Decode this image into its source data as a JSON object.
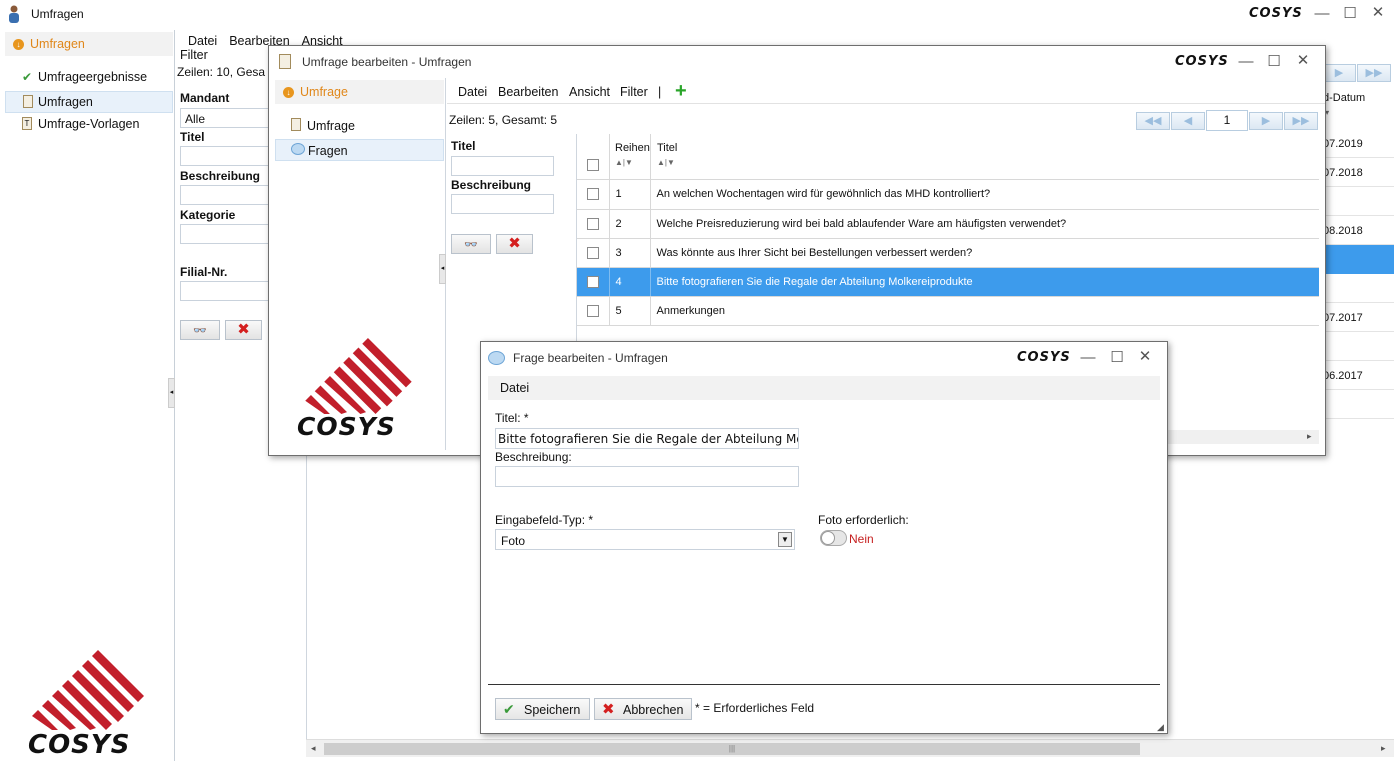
{
  "main_window": {
    "title": "Umfragen",
    "nav_header": "Umfragen",
    "nav_items": [
      {
        "label": "Umfrageergebnisse",
        "icon": "check-doc-icon"
      },
      {
        "label": "Umfragen",
        "icon": "clipboard-icon"
      },
      {
        "label": "Umfrage-Vorlagen",
        "icon": "template-icon"
      }
    ],
    "menu": [
      "Datei",
      "Bearbeiten",
      "Ansicht",
      "Filter"
    ],
    "rows_info": "Zeilen: 10, Gesa",
    "filters": {
      "mandant_label": "Mandant",
      "mandant_value": "Alle",
      "titel_label": "Titel",
      "beschreibung_label": "Beschreibung",
      "kategorie_label": "Kategorie",
      "filial_label": "Filial-Nr."
    },
    "column_header_partial": "d-Datum",
    "dates": [
      "07.2019",
      "07.2018",
      "08.2018",
      "07.2017",
      "06.2017"
    ]
  },
  "survey_window": {
    "title": "Umfrage bearbeiten - Umfragen",
    "nav_header": "Umfrage",
    "nav_items": [
      {
        "label": "Umfrage",
        "icon": "clipboard-icon"
      },
      {
        "label": "Fragen",
        "icon": "speech-bubble-icon"
      }
    ],
    "menu": [
      "Datei",
      "Bearbeiten",
      "Ansicht",
      "Filter",
      "|"
    ],
    "rows_info": "Zeilen: 5, Gesamt: 5",
    "page": "1",
    "filter_titel": "Titel",
    "filter_beschreibung": "Beschreibung",
    "columns": [
      "Reihen",
      "Titel"
    ],
    "rows": [
      {
        "nr": "1",
        "titel": "An welchen Wochentagen wird für gewöhnlich das MHD kontrolliert?"
      },
      {
        "nr": "2",
        "titel": "Welche Preisreduzierung wird bei bald ablaufender Ware am häufigsten verwendet?"
      },
      {
        "nr": "3",
        "titel": "Was könnte aus Ihrer Sicht bei Bestellungen verbessert werden?"
      },
      {
        "nr": "4",
        "titel": "Bitte fotografieren Sie die Regale der Abteilung Molkereiprodukte"
      },
      {
        "nr": "5",
        "titel": "Anmerkungen"
      }
    ],
    "selected_row": 4
  },
  "question_dialog": {
    "title": "Frage bearbeiten - Umfragen",
    "menu": [
      "Datei"
    ],
    "titel_label": "Titel: *",
    "titel_value": "Bitte fotografieren Sie die Regale der Abteilung Molk",
    "beschreibung_label": "Beschreibung:",
    "beschreibung_value": "",
    "typ_label": "Eingabefeld-Typ: *",
    "typ_value": "Foto",
    "foto_label": "Foto erforderlich:",
    "foto_toggle": "Nein",
    "save_label": "Speichern",
    "cancel_label": "Abbrechen",
    "required_note": "* = Erforderliches Feld"
  },
  "brand": {
    "logo_text": "COSYS",
    "accent": "#e8961e",
    "stripe_color": "#c21f2b",
    "selection": "#3d9bec"
  }
}
